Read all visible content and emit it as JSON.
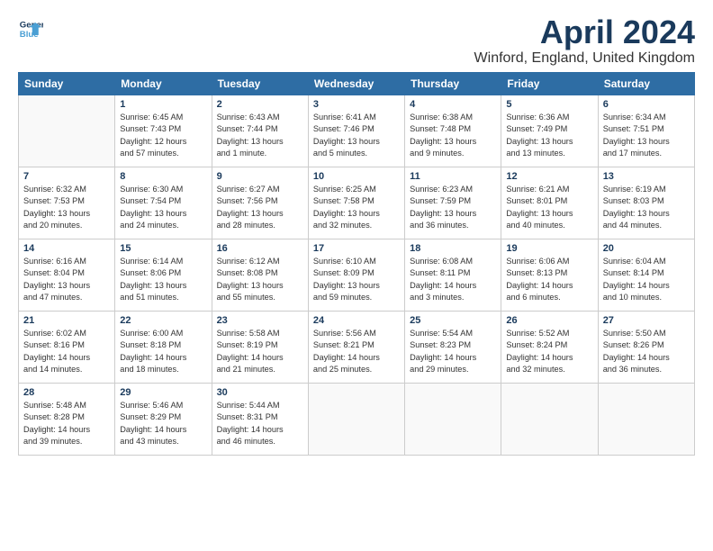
{
  "header": {
    "logo_line1": "General",
    "logo_line2": "Blue",
    "title": "April 2024",
    "subtitle": "Winford, England, United Kingdom"
  },
  "weekdays": [
    "Sunday",
    "Monday",
    "Tuesday",
    "Wednesday",
    "Thursday",
    "Friday",
    "Saturday"
  ],
  "weeks": [
    [
      {
        "day": "",
        "info": ""
      },
      {
        "day": "1",
        "info": "Sunrise: 6:45 AM\nSunset: 7:43 PM\nDaylight: 12 hours\nand 57 minutes."
      },
      {
        "day": "2",
        "info": "Sunrise: 6:43 AM\nSunset: 7:44 PM\nDaylight: 13 hours\nand 1 minute."
      },
      {
        "day": "3",
        "info": "Sunrise: 6:41 AM\nSunset: 7:46 PM\nDaylight: 13 hours\nand 5 minutes."
      },
      {
        "day": "4",
        "info": "Sunrise: 6:38 AM\nSunset: 7:48 PM\nDaylight: 13 hours\nand 9 minutes."
      },
      {
        "day": "5",
        "info": "Sunrise: 6:36 AM\nSunset: 7:49 PM\nDaylight: 13 hours\nand 13 minutes."
      },
      {
        "day": "6",
        "info": "Sunrise: 6:34 AM\nSunset: 7:51 PM\nDaylight: 13 hours\nand 17 minutes."
      }
    ],
    [
      {
        "day": "7",
        "info": "Sunrise: 6:32 AM\nSunset: 7:53 PM\nDaylight: 13 hours\nand 20 minutes."
      },
      {
        "day": "8",
        "info": "Sunrise: 6:30 AM\nSunset: 7:54 PM\nDaylight: 13 hours\nand 24 minutes."
      },
      {
        "day": "9",
        "info": "Sunrise: 6:27 AM\nSunset: 7:56 PM\nDaylight: 13 hours\nand 28 minutes."
      },
      {
        "day": "10",
        "info": "Sunrise: 6:25 AM\nSunset: 7:58 PM\nDaylight: 13 hours\nand 32 minutes."
      },
      {
        "day": "11",
        "info": "Sunrise: 6:23 AM\nSunset: 7:59 PM\nDaylight: 13 hours\nand 36 minutes."
      },
      {
        "day": "12",
        "info": "Sunrise: 6:21 AM\nSunset: 8:01 PM\nDaylight: 13 hours\nand 40 minutes."
      },
      {
        "day": "13",
        "info": "Sunrise: 6:19 AM\nSunset: 8:03 PM\nDaylight: 13 hours\nand 44 minutes."
      }
    ],
    [
      {
        "day": "14",
        "info": "Sunrise: 6:16 AM\nSunset: 8:04 PM\nDaylight: 13 hours\nand 47 minutes."
      },
      {
        "day": "15",
        "info": "Sunrise: 6:14 AM\nSunset: 8:06 PM\nDaylight: 13 hours\nand 51 minutes."
      },
      {
        "day": "16",
        "info": "Sunrise: 6:12 AM\nSunset: 8:08 PM\nDaylight: 13 hours\nand 55 minutes."
      },
      {
        "day": "17",
        "info": "Sunrise: 6:10 AM\nSunset: 8:09 PM\nDaylight: 13 hours\nand 59 minutes."
      },
      {
        "day": "18",
        "info": "Sunrise: 6:08 AM\nSunset: 8:11 PM\nDaylight: 14 hours\nand 3 minutes."
      },
      {
        "day": "19",
        "info": "Sunrise: 6:06 AM\nSunset: 8:13 PM\nDaylight: 14 hours\nand 6 minutes."
      },
      {
        "day": "20",
        "info": "Sunrise: 6:04 AM\nSunset: 8:14 PM\nDaylight: 14 hours\nand 10 minutes."
      }
    ],
    [
      {
        "day": "21",
        "info": "Sunrise: 6:02 AM\nSunset: 8:16 PM\nDaylight: 14 hours\nand 14 minutes."
      },
      {
        "day": "22",
        "info": "Sunrise: 6:00 AM\nSunset: 8:18 PM\nDaylight: 14 hours\nand 18 minutes."
      },
      {
        "day": "23",
        "info": "Sunrise: 5:58 AM\nSunset: 8:19 PM\nDaylight: 14 hours\nand 21 minutes."
      },
      {
        "day": "24",
        "info": "Sunrise: 5:56 AM\nSunset: 8:21 PM\nDaylight: 14 hours\nand 25 minutes."
      },
      {
        "day": "25",
        "info": "Sunrise: 5:54 AM\nSunset: 8:23 PM\nDaylight: 14 hours\nand 29 minutes."
      },
      {
        "day": "26",
        "info": "Sunrise: 5:52 AM\nSunset: 8:24 PM\nDaylight: 14 hours\nand 32 minutes."
      },
      {
        "day": "27",
        "info": "Sunrise: 5:50 AM\nSunset: 8:26 PM\nDaylight: 14 hours\nand 36 minutes."
      }
    ],
    [
      {
        "day": "28",
        "info": "Sunrise: 5:48 AM\nSunset: 8:28 PM\nDaylight: 14 hours\nand 39 minutes."
      },
      {
        "day": "29",
        "info": "Sunrise: 5:46 AM\nSunset: 8:29 PM\nDaylight: 14 hours\nand 43 minutes."
      },
      {
        "day": "30",
        "info": "Sunrise: 5:44 AM\nSunset: 8:31 PM\nDaylight: 14 hours\nand 46 minutes."
      },
      {
        "day": "",
        "info": ""
      },
      {
        "day": "",
        "info": ""
      },
      {
        "day": "",
        "info": ""
      },
      {
        "day": "",
        "info": ""
      }
    ]
  ]
}
